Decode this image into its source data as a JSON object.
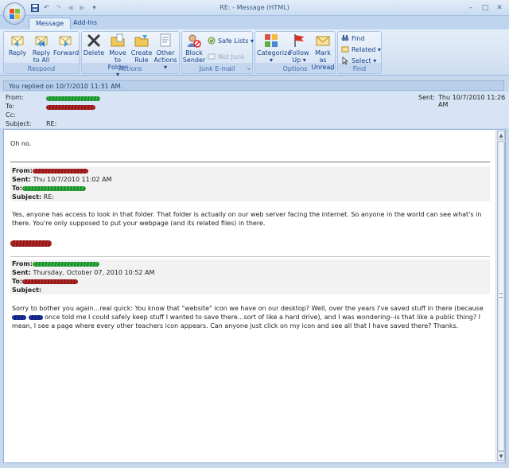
{
  "window": {
    "title": "RE:  - Message (HTML)"
  },
  "qat": {
    "save_icon": "save-icon",
    "undo_icon": "undo-icon",
    "redo_icon": "redo-icon",
    "prev_icon": "up-arrow-icon",
    "next_icon": "down-arrow-icon",
    "customize": "▾"
  },
  "window_controls": {
    "minimize": "–",
    "maximize": "□",
    "close": "✕"
  },
  "tabs": [
    {
      "label": "Message"
    },
    {
      "label": "Add-Ins"
    }
  ],
  "ribbon": {
    "respond": {
      "label": "Respond",
      "reply": "Reply",
      "reply_all_1": "Reply",
      "reply_all_2": "to All",
      "forward": "Forward"
    },
    "actions": {
      "label": "Actions",
      "delete": "Delete",
      "move_1": "Move to",
      "move_2": "Folder ▾",
      "rule_1": "Create",
      "rule_2": "Rule",
      "other_1": "Other",
      "other_2": "Actions ▾"
    },
    "junk": {
      "label": "Junk E-mail",
      "block_1": "Block",
      "block_2": "Sender",
      "safe_lists": "Safe Lists ▾",
      "not_junk": "Not Junk"
    },
    "options": {
      "label": "Options",
      "categorize_1": "Categorize",
      "categorize_2": "▾",
      "follow_1": "Follow",
      "follow_2": "Up ▾",
      "mark_1": "Mark as",
      "mark_2": "Unread"
    },
    "find": {
      "label": "Find",
      "find": "Find",
      "related": "Related ▾",
      "select": "Select ▾"
    }
  },
  "infobar": {
    "text": "You replied on 10/7/2010 11:31 AM."
  },
  "header": {
    "from_label": "From:",
    "to_label": "To:",
    "cc_label": "Cc:",
    "subject_label": "Subject:",
    "subject_value": "RE:",
    "sent_label": "Sent:",
    "sent_value": "Thu 10/7/2010 11:26 AM"
  },
  "body": {
    "greeting": "Oh no.",
    "quote1": {
      "from_label": "From:",
      "sent_label": "Sent:",
      "sent_value": " Thu 10/7/2010 11:02 AM",
      "to_label": "To:",
      "subject_label": "Subject:",
      "subject_value": " RE:",
      "text": "Yes, anyone has access to look in that folder. That folder is actually on our web server facing the internet. So anyone in the world can see what's in there. You're only supposed to put your webpage (and its related files) in there."
    },
    "quote2": {
      "from_label": "From:",
      "sent_label": "Sent:",
      "sent_value": " Thursday, October 07, 2010 10:52 AM",
      "to_label": "To:",
      "subject_label": "Subject:",
      "text_a": "Sorry to bother you again...real quick: You know that \"website\" icon we have on our desktop? Well, over the years I've saved stuff in there (because",
      "text_b": " once told me I could safely keep stuff I wanted to save there...sort of like a hard drive), and I was wondering--is that like a public thing? I mean, I see a page where every other teachers icon appears. Can anyone just click on my icon and see all that I have saved there? Thanks."
    }
  },
  "scrollbar": {
    "up": "▲",
    "down": "▼"
  },
  "colors": {
    "ribbon_text": "#15428b",
    "redact_green": "#1a8a2a",
    "redact_red": "#8a1414",
    "redact_blue": "#0d1f7a"
  }
}
